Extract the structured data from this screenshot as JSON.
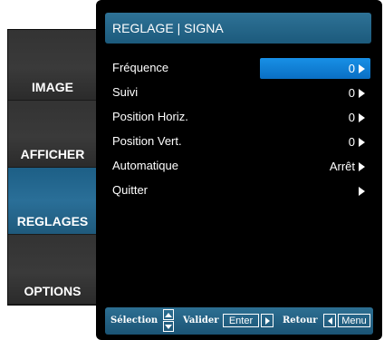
{
  "tabs": [
    {
      "label": "IMAGE",
      "active": false
    },
    {
      "label": "AFFICHER",
      "active": false
    },
    {
      "label": "REGLAGES",
      "active": true
    },
    {
      "label": "OPTIONS",
      "active": false
    }
  ],
  "header": {
    "title": "REGLAGE | SIGNA"
  },
  "items": [
    {
      "label": "Fréquence",
      "value": "0",
      "selected": true
    },
    {
      "label": "Suivi",
      "value": "0",
      "selected": false
    },
    {
      "label": "Position Horiz.",
      "value": "0",
      "selected": false
    },
    {
      "label": "Position Vert.",
      "value": "0",
      "selected": false
    },
    {
      "label": "Automatique",
      "value": "Arrêt",
      "selected": false
    },
    {
      "label": "Quitter",
      "value": "",
      "selected": false
    }
  ],
  "footer": {
    "select_label": "Sélection",
    "validate_label": "Valider",
    "enter_key": "Enter",
    "back_label": "Retour",
    "menu_key": "Menu"
  },
  "colors": {
    "accent": "#1a8ee4",
    "active_tab": "#256a92",
    "header": "#246689"
  }
}
